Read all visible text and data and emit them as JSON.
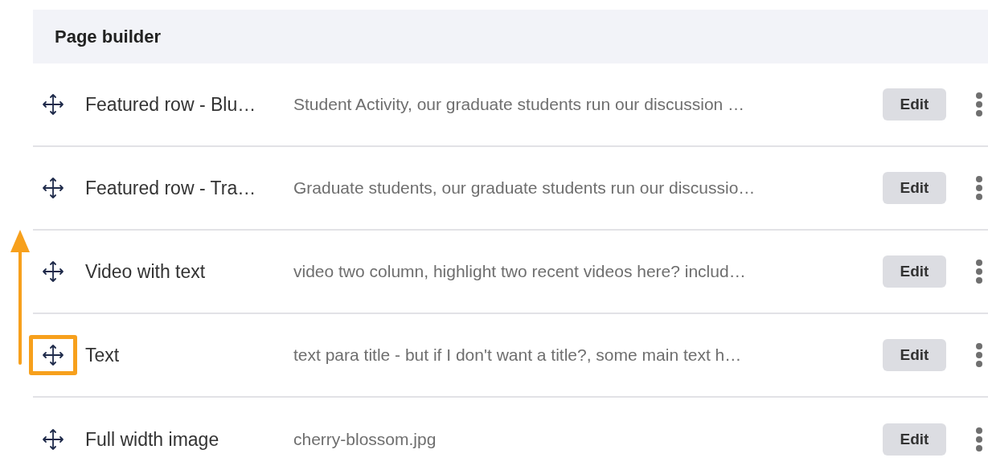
{
  "header": {
    "title": "Page builder"
  },
  "rows": [
    {
      "name": "Featured row - Blu…",
      "summary": "Student Activity, our graduate students run our discussion …",
      "button": "Edit",
      "highlighted": false
    },
    {
      "name": "Featured row - Tra…",
      "summary": "Graduate students, our graduate students run our discussio…",
      "button": "Edit",
      "highlighted": false
    },
    {
      "name": "Video with text",
      "summary": "video two column, highlight two recent videos here? includ…",
      "button": "Edit",
      "highlighted": false
    },
    {
      "name": "Text",
      "summary": "text para title - but if I don't want a title?, some main text h…",
      "button": "Edit",
      "highlighted": true
    },
    {
      "name": "Full width image",
      "summary": "cherry-blossom.jpg",
      "button": "Edit",
      "highlighted": false
    }
  ]
}
